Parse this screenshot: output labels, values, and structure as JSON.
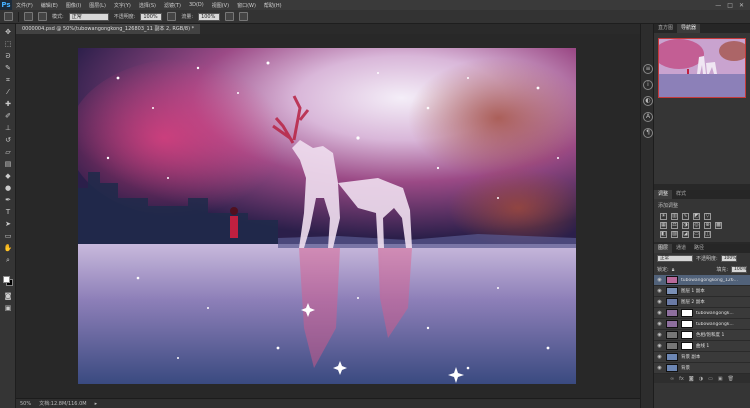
{
  "app": {
    "logo": "Ps"
  },
  "menu": [
    "文件(F)",
    "编辑(E)",
    "图像(I)",
    "图层(L)",
    "文字(Y)",
    "选择(S)",
    "滤镜(T)",
    "3D(D)",
    "视图(V)",
    "窗口(W)",
    "帮助(H)"
  ],
  "window_controls": {
    "minimize": "—",
    "maximize": "□",
    "close": "✕"
  },
  "options": {
    "mode_label": "模式:",
    "mode_value": "正常",
    "opacity_label": "不透明度:",
    "opacity_value": "100%",
    "flow_label": "流量:",
    "flow_value": "100%"
  },
  "document": {
    "tab_label": "0000004.psd @ 50%(tubowangongkong_126803_11 副本 2, RGB/8) *"
  },
  "status": {
    "zoom": "50%",
    "doc_info": "文档:12.8M/116.0M"
  },
  "navigator": {
    "tabs": [
      "直方图",
      "导航器"
    ],
    "active": 1
  },
  "adjustments": {
    "tabs": [
      "调整",
      "样式"
    ],
    "title": "添加调整"
  },
  "layers": {
    "tabs": [
      "图层",
      "通道",
      "路径"
    ],
    "blend_mode": "正常",
    "opacity_label": "不透明度:",
    "opacity_value": "100%",
    "fill_label": "填充:",
    "fill_value": "100%",
    "lock_label": "锁定:",
    "items": [
      {
        "name": "tubowangongkong_126...",
        "selected": true,
        "mask": false,
        "thumb": "#b86a9a"
      },
      {
        "name": "图层 1 副本",
        "selected": false,
        "mask": false,
        "thumb": "#7a8fb5"
      },
      {
        "name": "图层 2 副本",
        "selected": false,
        "mask": false,
        "thumb": "#6a7aa5"
      },
      {
        "name": "tubowangongk...",
        "selected": false,
        "mask": true,
        "thumb": "#8e6f9e"
      },
      {
        "name": "tubowangongk...",
        "selected": false,
        "mask": true,
        "thumb": "#8e6f9e"
      },
      {
        "name": "色相/饱和度 1",
        "selected": false,
        "mask": true,
        "thumb": "#777777"
      },
      {
        "name": "曲线 1",
        "selected": false,
        "mask": true,
        "thumb": "#777777"
      },
      {
        "name": "背景 副本",
        "selected": false,
        "mask": false,
        "thumb": "#6c86b3"
      },
      {
        "name": "背景",
        "selected": false,
        "mask": false,
        "thumb": "#6c86b3"
      }
    ],
    "footer_icons": [
      "link-icon",
      "fx-icon",
      "mask-icon",
      "adjustment-icon",
      "folder-icon",
      "new-layer-icon",
      "trash-icon"
    ]
  }
}
